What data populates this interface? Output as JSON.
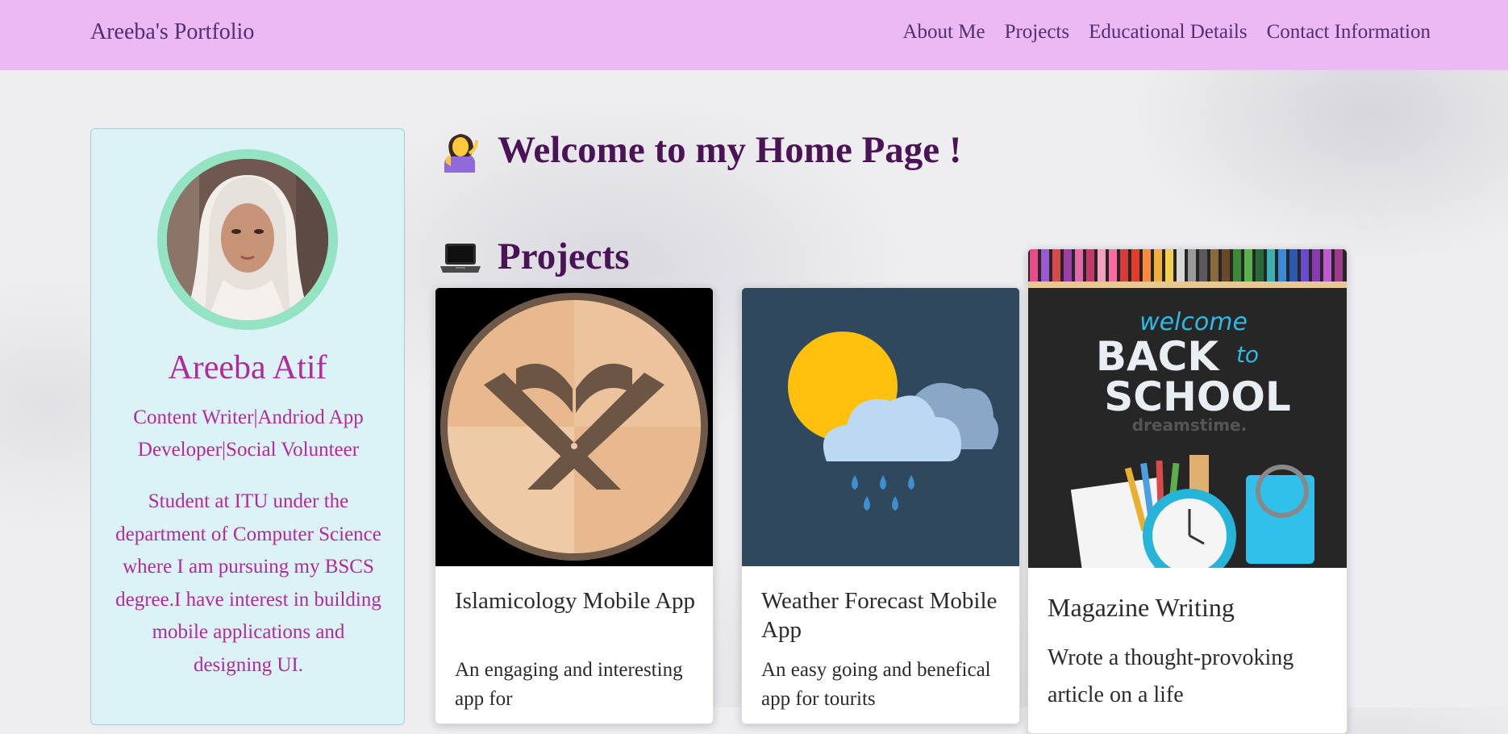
{
  "navbar": {
    "brand": "Areeba's Portfolio",
    "links": [
      "About Me",
      "Projects",
      "Educational Details",
      "Contact Information"
    ],
    "background": "#edb9f5"
  },
  "profile": {
    "name": "Areeba Atif",
    "role": "Content Writer|Andriod App Developer|Social Volunteer",
    "bio": "Student at ITU under the department of Computer Science where I am pursuing my BSCS degree.I have interest in building mobile applications and designing UI."
  },
  "welcome": {
    "emoji": "person-tipping-hand-icon",
    "text": "Welcome to my Home Page !"
  },
  "projects_section": {
    "emoji": "laptop-icon",
    "heading": "Projects",
    "cards": [
      {
        "title": "Islamicology Mobile App",
        "text": "An engaging and interesting app for",
        "image": "quran-stand-icon"
      },
      {
        "title": "Weather Forecast Mobile App",
        "text": "An easy going and benefical app for tourits",
        "image": "weather-sun-cloud-rain-icon"
      },
      {
        "title": "Magazine Writing",
        "text": "Wrote a thought-provoking article on a life",
        "image": "back-to-school-image",
        "image_text": {
          "welcome": "welcome",
          "back": "BACK",
          "to": "to",
          "school": "SCHOOL",
          "watermark": "dreamstime."
        }
      }
    ]
  },
  "colors": {
    "accent_text": "#b12a9e",
    "heading": "#4a1356",
    "nav_text": "#4d2f76",
    "profile_bg": "#dbf3f6"
  }
}
